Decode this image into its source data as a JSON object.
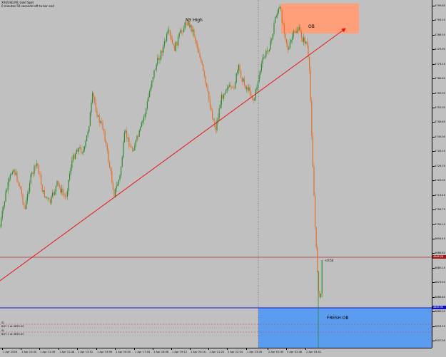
{
  "header": {
    "symbol_line": "XAUUSD,M1  Gold Spot",
    "timer_line": "0 minutes 59 seconds left to bar end"
  },
  "annotations": {
    "ny_high": "NY High",
    "ob": "OB",
    "fresh_ob": "FRESH OB",
    "countdown": "<0:54"
  },
  "orders": [
    {
      "side": "SL",
      "label": "SL"
    },
    {
      "side": "BUY",
      "label": "BUY 1 at 4659.00"
    },
    {
      "side": "SL",
      "label": "SL"
    },
    {
      "side": "BUY",
      "label": "BUY 1 at 4650.40"
    }
  ],
  "price_axis": {
    "labels": [
      "4799.85",
      "4793.20",
      "4786.55",
      "4779.90",
      "4773.25",
      "4766.60",
      "4759.95",
      "4753.30",
      "4746.65",
      "4740.00",
      "4733.35",
      "4726.70",
      "4720.05",
      "4713.40",
      "4706.75",
      "4700.10",
      "4693.45",
      "4686.80",
      "4680.15",
      "4673.50",
      "4666.85",
      "4660.20",
      "4653.55",
      "4647.00"
    ],
    "current_price_tag": "4688.28",
    "support_price_tag": "4665.95"
  },
  "time_axis": {
    "labels": [
      "1 Apr 2026",
      "1 Apr 10:40",
      "1 Apr 11:44",
      "1 Apr 12:48",
      "1 Apr 13:52",
      "1 Apr 14:56",
      "1 Apr 16:00",
      "1 Apr 17:04",
      "1 Apr 18:08",
      "1 Apr 19:12",
      "1 Apr 20:16",
      "1 Apr 21:20",
      "1 Apr 22:24",
      "1 Apr 23:28",
      "2 Apr 01:44",
      "2 Apr 02:48",
      "2 Apr 03:52"
    ]
  },
  "colors": {
    "background": "#c0c0c0",
    "bull_candle": "#2e8b2e",
    "bear_candle": "#e0702a",
    "trendline": "#e81414",
    "resistance_line": "#b03030",
    "support_line": "#1010e0",
    "fresh_ob_zone": "#5b9bf0",
    "ob_zone": "#ff9f7a",
    "price_tag_bg": "#a01818",
    "support_tag_bg": "#1010c0"
  }
}
